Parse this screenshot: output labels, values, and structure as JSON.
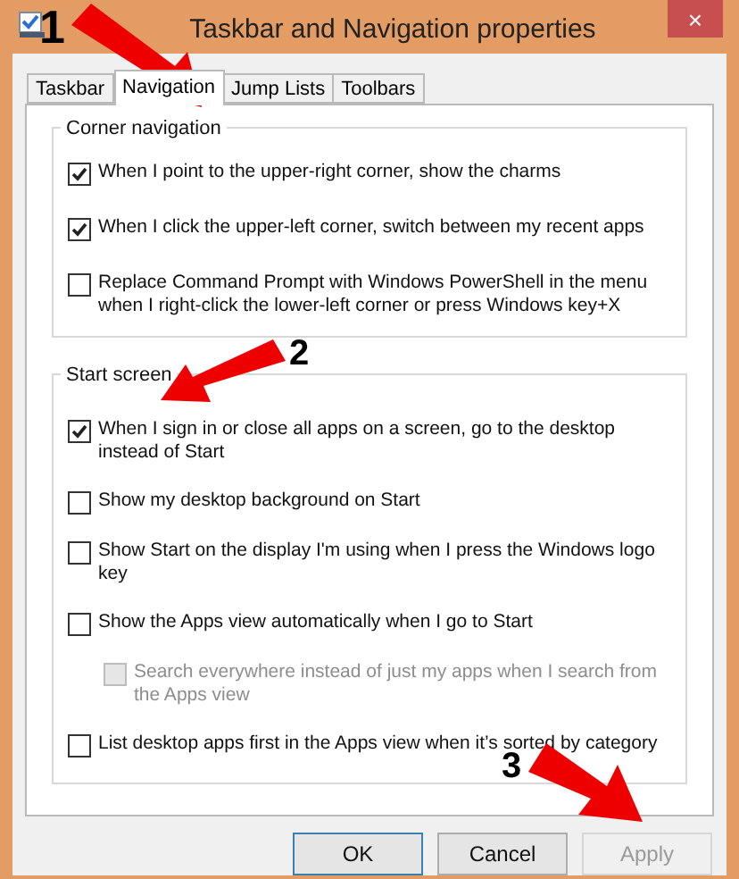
{
  "window": {
    "title": "Taskbar and Navigation properties",
    "close": "×"
  },
  "tabs": [
    {
      "label": "Taskbar",
      "selected": false
    },
    {
      "label": "Navigation",
      "selected": true
    },
    {
      "label": "Jump Lists",
      "selected": false
    },
    {
      "label": "Toolbars",
      "selected": false
    }
  ],
  "groups": [
    {
      "title": "Corner navigation",
      "items": [
        {
          "label": "When I point to the upper-right corner, show the charms",
          "checked": true,
          "disabled": false,
          "indented": false
        },
        {
          "label": "When I click the upper-left corner, switch between my recent apps",
          "checked": true,
          "disabled": false,
          "indented": false
        },
        {
          "label": "Replace Command Prompt with Windows PowerShell in the menu when I right-click the lower-left corner or press Windows key+X",
          "checked": false,
          "disabled": false,
          "indented": false
        }
      ]
    },
    {
      "title": "Start screen",
      "items": [
        {
          "label": "When I sign in or close all apps on a screen, go to the desktop instead of Start",
          "checked": true,
          "disabled": false,
          "indented": false
        },
        {
          "label": "Show my desktop background on Start",
          "checked": false,
          "disabled": false,
          "indented": false
        },
        {
          "label": "Show Start on the display I'm using when I press the Windows logo key",
          "checked": false,
          "disabled": false,
          "indented": false
        },
        {
          "label": "Show the Apps view automatically when I go to Start",
          "checked": false,
          "disabled": false,
          "indented": false
        },
        {
          "label": "Search everywhere instead of just my apps when I search from the Apps view",
          "checked": false,
          "disabled": true,
          "indented": true
        },
        {
          "label": "List desktop apps first in the Apps view when it’s sorted by category",
          "checked": false,
          "disabled": false,
          "indented": false
        }
      ]
    }
  ],
  "buttons": [
    {
      "label": "OK",
      "disabled": false,
      "default": true
    },
    {
      "label": "Cancel",
      "disabled": false,
      "default": false
    },
    {
      "label": "Apply",
      "disabled": true,
      "default": false
    }
  ],
  "annotations": [
    "1",
    "2",
    "3"
  ]
}
